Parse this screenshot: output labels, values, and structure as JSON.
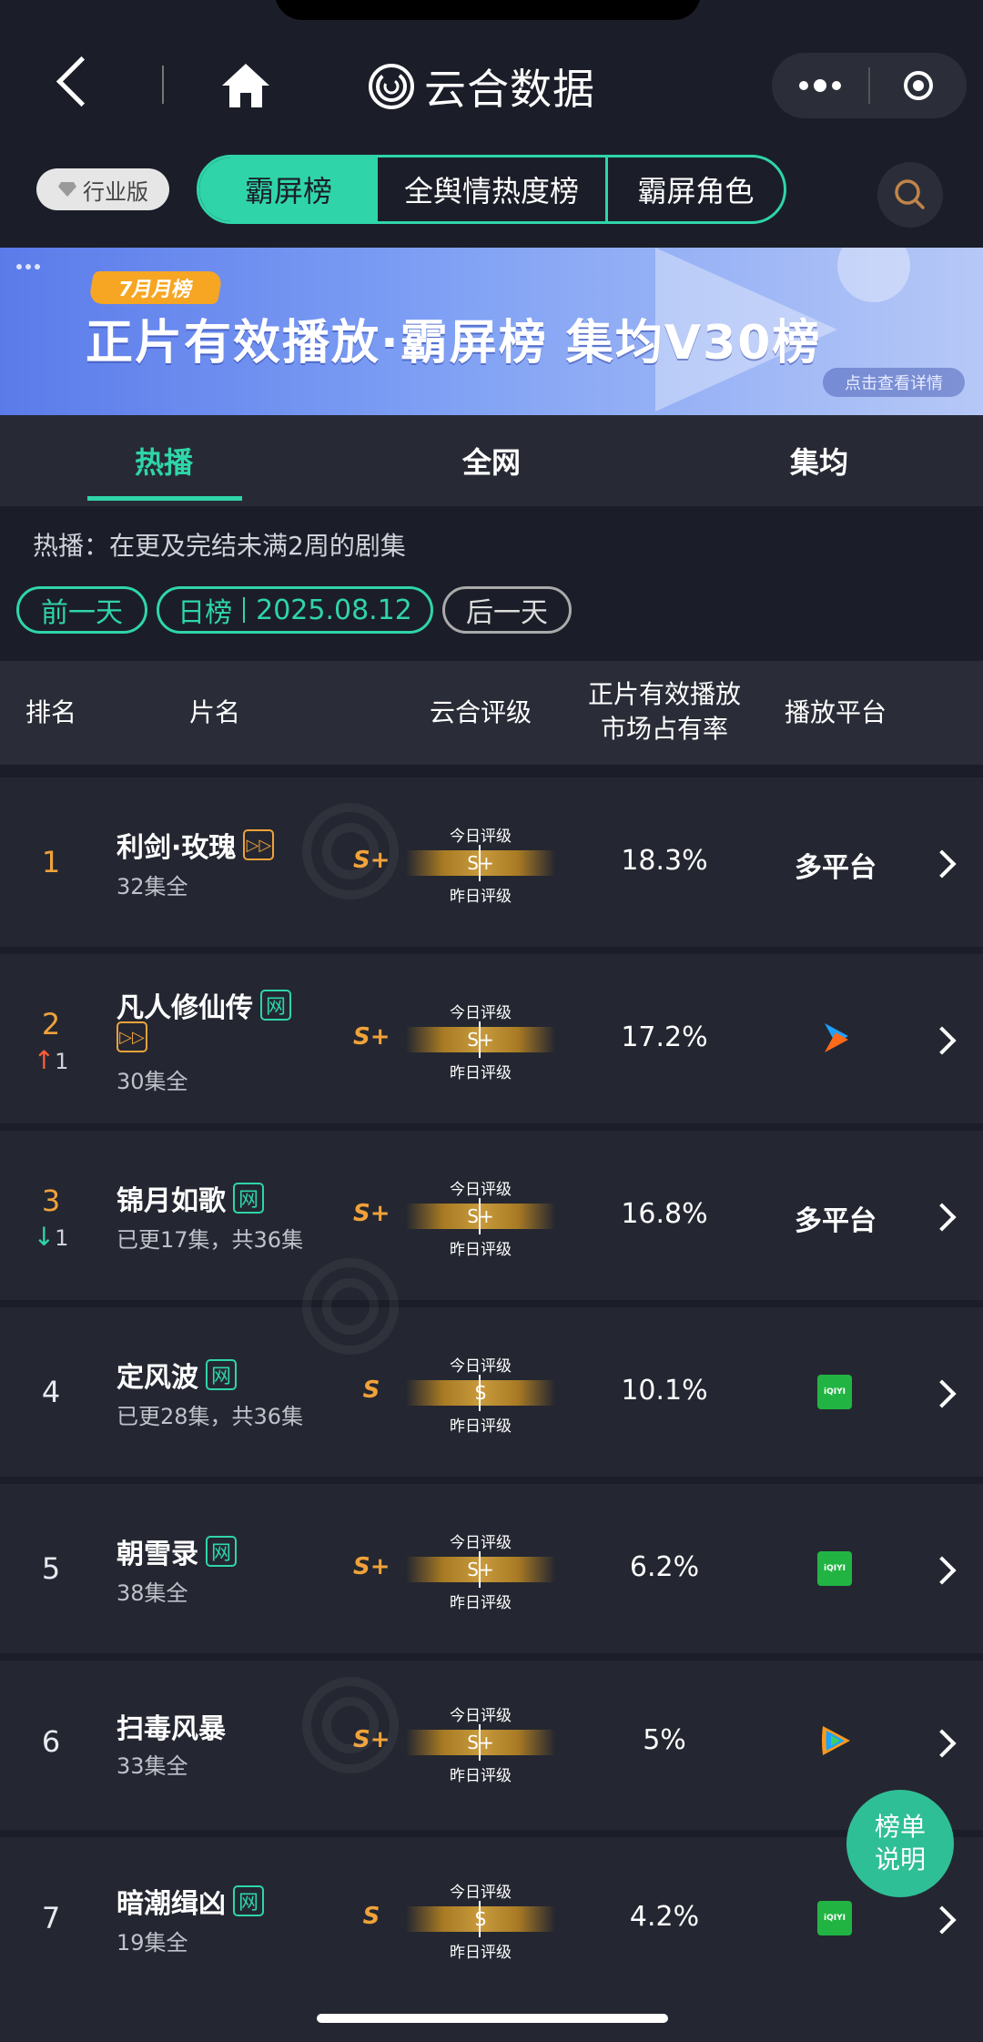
{
  "brand": {
    "title": "云合数据"
  },
  "toolbar": {
    "industry_label": "行业版"
  },
  "segments": [
    {
      "label": "霸屏榜",
      "active": true
    },
    {
      "label": "全舆情热度榜",
      "active": false
    },
    {
      "label": "霸屏角色",
      "active": false
    }
  ],
  "banner": {
    "tag": "7月月榜",
    "title": "正片有效播放·霸屏榜 集均V30榜",
    "detail": "点击查看详情"
  },
  "tabs": [
    {
      "label": "热播",
      "active": true
    },
    {
      "label": "全网",
      "active": false
    },
    {
      "label": "集均",
      "active": false
    }
  ],
  "description": "热播：在更及完结未满2周的剧集",
  "filters": {
    "prev": "前一天",
    "mode": "日榜",
    "date": "2025.08.12",
    "next": "后一天"
  },
  "table": {
    "headers": {
      "rank": "排名",
      "name": "片名",
      "grade": "云合评级",
      "share_line1": "正片有效播放",
      "share_line2": "市场占有率",
      "platform": "播放平台"
    },
    "grade_today_label": "今日评级",
    "grade_yesterday_label": "昨日评级",
    "rows": [
      {
        "rank": "1",
        "title": "利剑·玫瑰",
        "episodes": "32集全",
        "grade": "S+",
        "bar_grade": "S+",
        "share": "18.3%",
        "platform": "多平台",
        "platform_icon": "multi-platform-text"
      },
      {
        "rank": "2",
        "trend_dir": "up",
        "trend_val": "1",
        "title": "凡人修仙传",
        "net_tag": "网",
        "episodes": "30集全",
        "grade": "S+",
        "bar_grade": "S+",
        "share": "17.2%",
        "platform": "",
        "platform_icon": "youku-icon"
      },
      {
        "rank": "3",
        "trend_dir": "down",
        "trend_val": "1",
        "title": "锦月如歌",
        "net_tag": "网",
        "episodes": "已更17集，共36集",
        "grade": "S+",
        "bar_grade": "S+",
        "share": "16.8%",
        "platform": "多平台",
        "platform_icon": "multi-platform-text"
      },
      {
        "rank": "4",
        "title": "定风波",
        "net_tag": "网",
        "episodes": "已更28集，共36集",
        "grade": "S",
        "bar_grade": "S",
        "share": "10.1%",
        "platform": "",
        "platform_icon": "iqiyi-icon",
        "iqiyi_text": "iQIYI"
      },
      {
        "rank": "5",
        "title": "朝雪录",
        "net_tag": "网",
        "episodes": "38集全",
        "grade": "S+",
        "bar_grade": "S+",
        "share": "6.2%",
        "platform": "",
        "platform_icon": "iqiyi-icon",
        "iqiyi_text": "iQIYI"
      },
      {
        "rank": "6",
        "title": "扫毒风暴",
        "episodes": "33集全",
        "grade": "S+",
        "bar_grade": "S+",
        "share": "5%",
        "platform": "",
        "platform_icon": "tencent-video-icon"
      },
      {
        "rank": "7",
        "title": "暗潮缉凶",
        "net_tag": "网",
        "episodes": "19集全",
        "grade": "S",
        "bar_grade": "S",
        "share": "4.2%",
        "platform": "",
        "platform_icon": "iqiyi-icon",
        "iqiyi_text": "iQIYI"
      }
    ]
  },
  "fab": {
    "line1": "榜单",
    "line2": "说明"
  },
  "colors": {
    "accent": "#2fd5a8",
    "gold": "#f0a23a",
    "background": "#1b1e28",
    "row": "#242731"
  }
}
